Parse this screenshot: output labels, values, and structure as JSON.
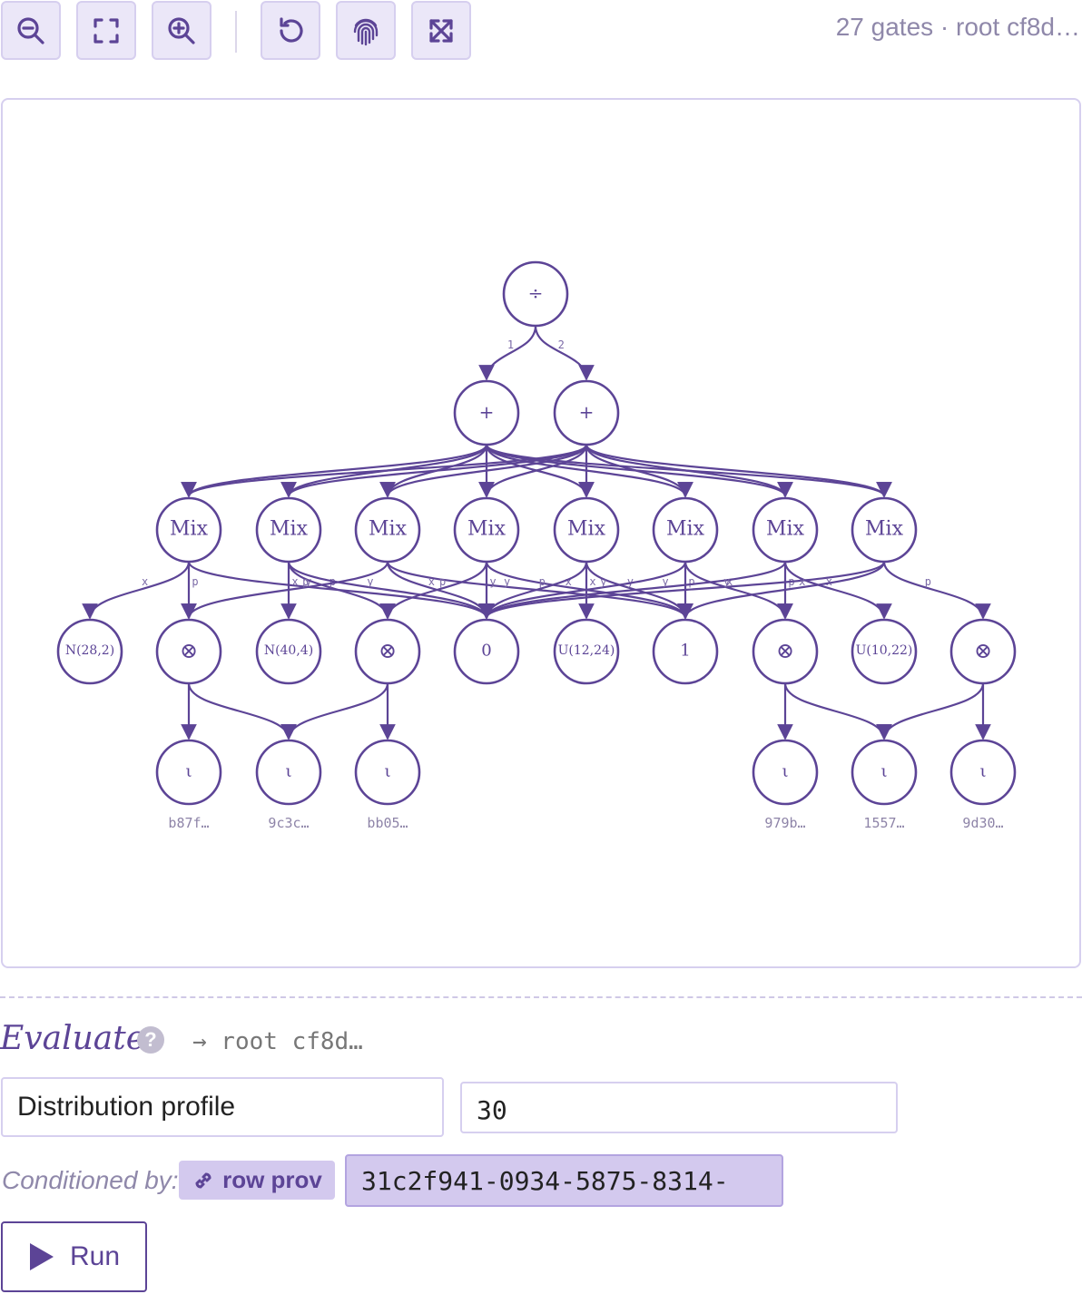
{
  "toolbar": {
    "buttons": [
      {
        "name": "zoom-out-button",
        "icon": "zoom-out-icon"
      },
      {
        "name": "fit-view-button",
        "icon": "fit-view-icon"
      },
      {
        "name": "zoom-in-button",
        "icon": "zoom-in-icon"
      },
      {
        "name": "reset-button",
        "icon": "undo-icon"
      },
      {
        "name": "fingerprint-button",
        "icon": "fingerprint-icon"
      },
      {
        "name": "fullscreen-button",
        "icon": "expand-arrows-icon"
      }
    ],
    "status": "27 gates · root cf8d…"
  },
  "graph": {
    "nodes": [
      {
        "id": "div",
        "label": "÷"
      },
      {
        "id": "p1",
        "label": "+"
      },
      {
        "id": "p2",
        "label": "+"
      },
      {
        "id": "m1",
        "label": "Mix"
      },
      {
        "id": "m2",
        "label": "Mix"
      },
      {
        "id": "m3",
        "label": "Mix"
      },
      {
        "id": "m4",
        "label": "Mix"
      },
      {
        "id": "m5",
        "label": "Mix"
      },
      {
        "id": "m6",
        "label": "Mix"
      },
      {
        "id": "m7",
        "label": "Mix"
      },
      {
        "id": "m8",
        "label": "Mix"
      },
      {
        "id": "n28",
        "label": "N(28,2)"
      },
      {
        "id": "t1",
        "label": "⊗"
      },
      {
        "id": "n40",
        "label": "N(40,4)"
      },
      {
        "id": "t2",
        "label": "⊗"
      },
      {
        "id": "zero",
        "label": "0"
      },
      {
        "id": "u12",
        "label": "U(12,24)"
      },
      {
        "id": "one",
        "label": "1"
      },
      {
        "id": "t3",
        "label": "⊗"
      },
      {
        "id": "u10",
        "label": "U(10,22)"
      },
      {
        "id": "t4",
        "label": "⊗"
      },
      {
        "id": "l1",
        "label": "ι",
        "sub": "b87f…"
      },
      {
        "id": "l2",
        "label": "ι",
        "sub": "9c3c…"
      },
      {
        "id": "l3",
        "label": "ι",
        "sub": "bb05…"
      },
      {
        "id": "l4",
        "label": "ι",
        "sub": "979b…"
      },
      {
        "id": "l5",
        "label": "ι",
        "sub": "1557…"
      },
      {
        "id": "l6",
        "label": "ι",
        "sub": "9d30…"
      }
    ],
    "edges": [
      {
        "from": "div",
        "to": "p1",
        "label": "1"
      },
      {
        "from": "div",
        "to": "p2",
        "label": "2"
      },
      {
        "from": "p1",
        "to": "m1"
      },
      {
        "from": "p1",
        "to": "m2"
      },
      {
        "from": "p1",
        "to": "m3"
      },
      {
        "from": "p1",
        "to": "m4"
      },
      {
        "from": "p1",
        "to": "m5"
      },
      {
        "from": "p1",
        "to": "m6"
      },
      {
        "from": "p1",
        "to": "m7"
      },
      {
        "from": "p1",
        "to": "m8"
      },
      {
        "from": "p2",
        "to": "m1"
      },
      {
        "from": "p2",
        "to": "m2"
      },
      {
        "from": "p2",
        "to": "m3"
      },
      {
        "from": "p2",
        "to": "m4"
      },
      {
        "from": "p2",
        "to": "m5"
      },
      {
        "from": "p2",
        "to": "m6"
      },
      {
        "from": "p2",
        "to": "m7"
      },
      {
        "from": "p2",
        "to": "m8"
      },
      {
        "from": "m1",
        "to": "n28",
        "label": "x"
      },
      {
        "from": "m1",
        "to": "t1",
        "label": "p"
      },
      {
        "from": "m1",
        "to": "zero",
        "label": "y"
      },
      {
        "from": "m2",
        "to": "n40",
        "label": "x"
      },
      {
        "from": "m2",
        "to": "t2",
        "label": "p"
      },
      {
        "from": "m2",
        "to": "zero",
        "label": "y"
      },
      {
        "from": "m3",
        "to": "t1",
        "label": "p"
      },
      {
        "from": "m3",
        "to": "zero",
        "label": "x"
      },
      {
        "from": "m3",
        "to": "one",
        "label": "y"
      },
      {
        "from": "m4",
        "to": "t2",
        "label": "p"
      },
      {
        "from": "m4",
        "to": "zero",
        "label": "y"
      },
      {
        "from": "m4",
        "to": "one",
        "label": "x"
      },
      {
        "from": "m5",
        "to": "u12",
        "label": "x"
      },
      {
        "from": "m5",
        "to": "zero",
        "label": "p"
      },
      {
        "from": "m5",
        "to": "one",
        "label": "y"
      },
      {
        "from": "m6",
        "to": "one",
        "label": "p"
      },
      {
        "from": "m6",
        "to": "t3",
        "label": "x"
      },
      {
        "from": "m6",
        "to": "zero",
        "label": "y"
      },
      {
        "from": "m7",
        "to": "zero",
        "label": "y"
      },
      {
        "from": "m7",
        "to": "t3",
        "label": "p"
      },
      {
        "from": "m7",
        "to": "u10",
        "label": "x"
      },
      {
        "from": "m8",
        "to": "zero",
        "label": "y"
      },
      {
        "from": "m8",
        "to": "t4",
        "label": "p"
      },
      {
        "from": "m8",
        "to": "one",
        "label": "x"
      },
      {
        "from": "t1",
        "to": "l1"
      },
      {
        "from": "t1",
        "to": "l2"
      },
      {
        "from": "t2",
        "to": "l2"
      },
      {
        "from": "t2",
        "to": "l3"
      },
      {
        "from": "t3",
        "to": "l4"
      },
      {
        "from": "t3",
        "to": "l5"
      },
      {
        "from": "t4",
        "to": "l5"
      },
      {
        "from": "t4",
        "to": "l6"
      }
    ]
  },
  "evaluate": {
    "title": "Evaluate",
    "help_icon": "question-icon",
    "root_ref": "→ root cf8d…",
    "mode_value": "Distribution profile",
    "number_value": "30",
    "conditioned_label": "Conditioned by:",
    "chip_icon": "link-icon",
    "chip_label": "row prov",
    "uuid_value": "31c2f941-0934-5875-8314-",
    "run_icon": "play-icon",
    "run_label": "Run"
  },
  "colors": {
    "accent": "#5c4496",
    "button_bg": "#ebe7f8",
    "border": "#d6cfef",
    "chip_bg": "#d3c9ee",
    "muted": "#8f88aa"
  }
}
